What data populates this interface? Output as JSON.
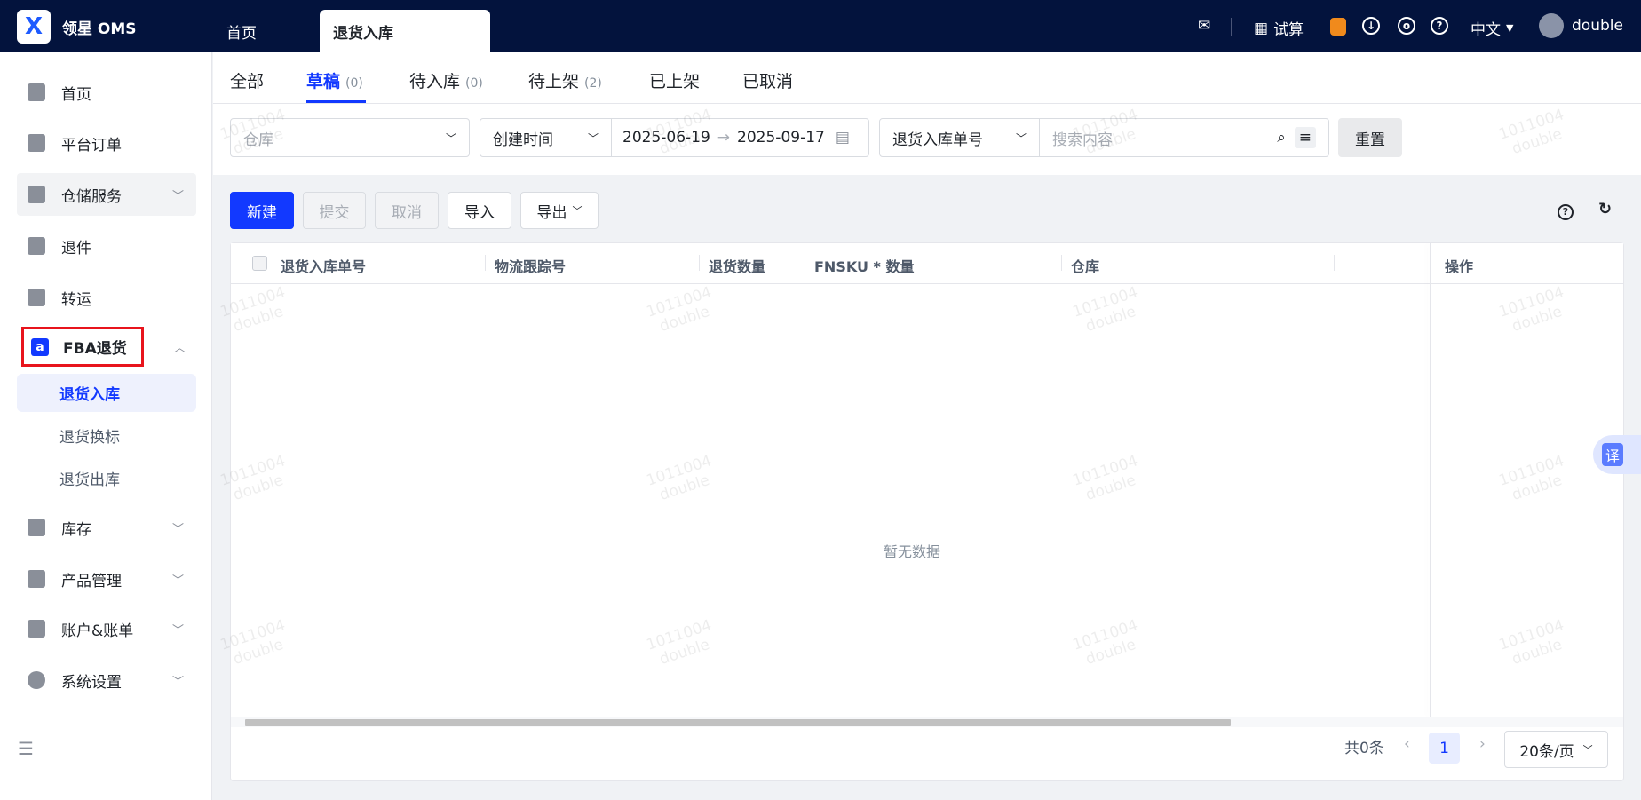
{
  "header": {
    "brand": "领星 OMS",
    "logo_letter": "X",
    "tabs": [
      "首页",
      "退货入库"
    ],
    "calc": "试算",
    "lang": "中文",
    "user": "double"
  },
  "sidebar": {
    "items": [
      {
        "label": "首页"
      },
      {
        "label": "平台订单"
      },
      {
        "label": "仓储服务"
      },
      {
        "label": "退件"
      },
      {
        "label": "转运"
      },
      {
        "label": "FBA退货"
      },
      {
        "label": "库存"
      },
      {
        "label": "产品管理"
      },
      {
        "label": "账户&账单"
      },
      {
        "label": "系统设置"
      }
    ],
    "sub_items": [
      "退货入库",
      "退货换标",
      "退货出库"
    ],
    "amazon_glyph": "a"
  },
  "status_tabs": [
    {
      "label": "全部",
      "count": ""
    },
    {
      "label": "草稿",
      "count": "(0)"
    },
    {
      "label": "待入库",
      "count": "(0)"
    },
    {
      "label": "待上架",
      "count": "(2)"
    },
    {
      "label": "已上架",
      "count": ""
    },
    {
      "label": "已取消",
      "count": ""
    }
  ],
  "filters": {
    "warehouse_placeholder": "仓库",
    "time_type": "创建时间",
    "date_start": "2025-06-19",
    "date_end": "2025-09-17",
    "search_field": "退货入库单号",
    "search_placeholder": "搜索内容",
    "reset": "重置"
  },
  "toolbar": {
    "new": "新建",
    "submit": "提交",
    "cancel": "取消",
    "import": "导入",
    "export": "导出"
  },
  "table": {
    "columns": [
      "退货入库单号",
      "物流跟踪号",
      "退货数量",
      "FNSKU * 数量",
      "仓库"
    ],
    "action_col": "操作",
    "empty": "暂无数据"
  },
  "pagination": {
    "total": "共0条",
    "page": "1",
    "page_size": "20条/页"
  },
  "translate": "译",
  "watermark": "1011004\ndouble",
  "colors": {
    "header_bg": "#03133d",
    "primary": "#1239ff",
    "highlight_border": "#e8141c"
  }
}
